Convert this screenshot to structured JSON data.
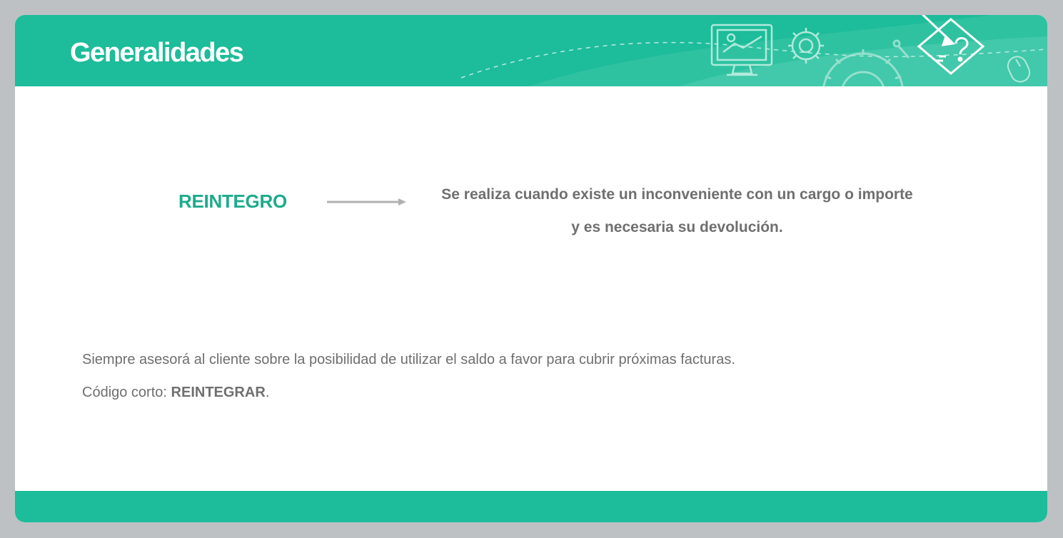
{
  "header": {
    "title": "Generalidades",
    "icons": [
      "computer-presentation-icon",
      "gear-icon",
      "large-gear-icon",
      "pencil-question-icon",
      "mouse-icon"
    ]
  },
  "concept": {
    "term": "REINTEGRO",
    "definition_line1": "Se realiza cuando existe un inconveniente con un cargo o importe",
    "definition_line2": "y es necesaria su devolución."
  },
  "note": {
    "advice": "Siempre asesorá al cliente sobre la posibilidad de utilizar el saldo a favor para cubrir próximas facturas.",
    "code_label": "Código corto:",
    "code_value": "REINTEGRAR",
    "code_suffix": "."
  },
  "colors": {
    "accent": "#1dbc9a",
    "term": "#1dab8c",
    "text": "#6f6f6f",
    "background": "#bdc1c4"
  }
}
